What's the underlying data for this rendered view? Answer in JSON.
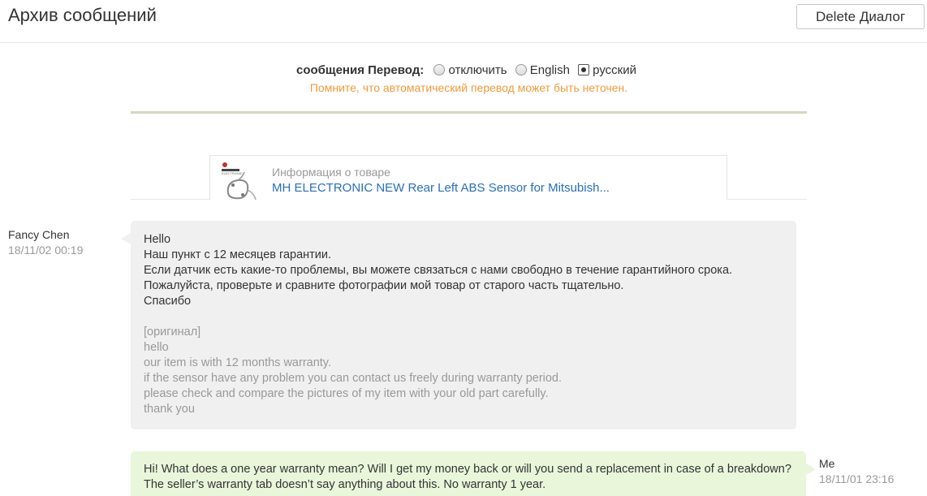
{
  "header": {
    "title": "Архив сообщений",
    "delete_button": "Delete Диалог"
  },
  "translation": {
    "label": "сообщения Перевод:",
    "options": [
      {
        "label": "отключить",
        "checked": false
      },
      {
        "label": "English",
        "checked": false
      },
      {
        "label": "русский",
        "checked": true
      }
    ],
    "warning": "Помните, что автоматический перевод может быть неточен."
  },
  "product": {
    "info_label": "Информация о товаре",
    "title": "MH ELECTRONIC NEW Rear Left ABS Sensor for Mitsubish..."
  },
  "messages": [
    {
      "sender": "Fancy Chen",
      "time": "18/11/02 00:19",
      "translated_lines": [
        "Hello",
        "Наш пункт с 12 месяцев гарантии.",
        "Если датчик есть какие-то проблемы, вы можете связаться с нами свободно в течение гарантийного срока.",
        "Пожалуйста, проверьте и сравните фотографии мой товар от старого часть тщательно.",
        "Спасибо"
      ],
      "original_label": "[оригинал]",
      "original_lines": [
        "hello",
        "our item is with 12 months warranty.",
        "if the sensor have any problem you can contact us freely during warranty period.",
        "please check and compare the pictures of my item with your old part carefully.",
        "thank you"
      ]
    },
    {
      "sender": "Me",
      "time": "18/11/01 23:16",
      "text": "Hi! What does a one year warranty mean? Will I get my money back or will you send a replacement in case of a breakdown? The seller’s warranty tab doesn’t say anything about this. No warranty 1 year."
    }
  ],
  "colors": {
    "warning": "#f29a3b",
    "link": "#2a6ebb",
    "incoming_bubble": "#f0f0f0",
    "outgoing_bubble": "#e9f6da"
  }
}
